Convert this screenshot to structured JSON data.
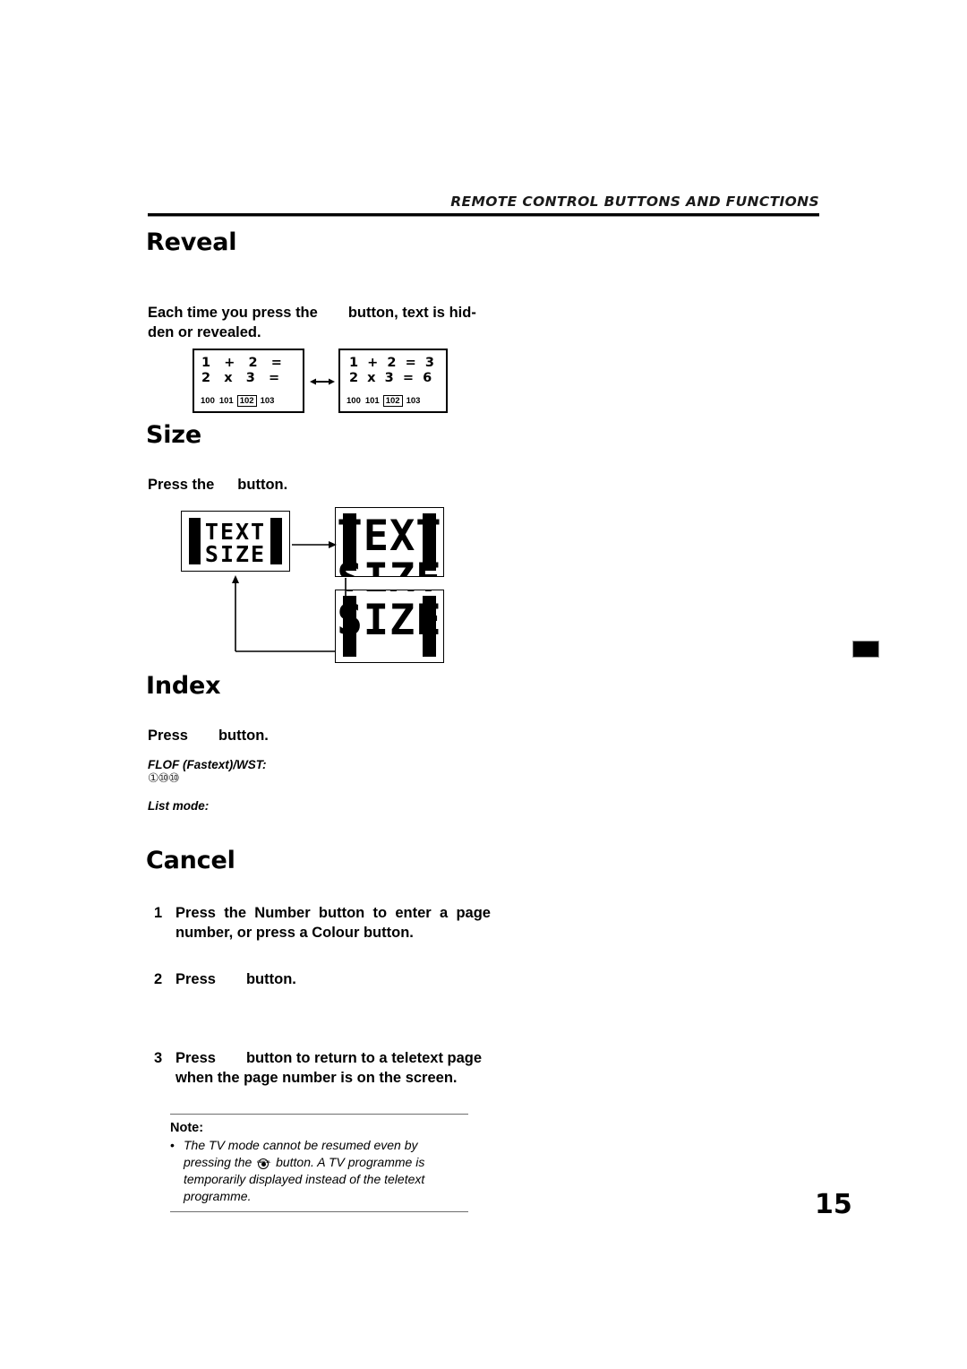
{
  "header": {
    "title": "REMOTE CONTROL BUTTONS AND FUNCTIONS"
  },
  "page_number": "15",
  "sections": {
    "reveal": {
      "heading": "Reveal",
      "paragraph_before": "Each time you press the",
      "paragraph_after": "button, text is hid-\nden or revealed.",
      "paragraph_part1": "Each time you press the",
      "paragraph_part2": "button, text is hid-",
      "paragraph_part3": "den or revealed.",
      "teletext": {
        "hidden_panel": {
          "line1": "1   +   2   =",
          "line2": "2   x   3   =",
          "pages": [
            "100",
            "101",
            "102",
            "103"
          ],
          "current_page": "102"
        },
        "revealed_panel": {
          "line1": "1  +  2  =  3",
          "line2": "2  x  3  =  6",
          "pages": [
            "100",
            "101",
            "102",
            "103"
          ],
          "current_page": "102"
        },
        "arrow": "double-headed-arrow"
      }
    },
    "size": {
      "heading": "Size",
      "paragraph_part1": "Press the",
      "paragraph_part2": "button.",
      "boxes": {
        "normal": {
          "line1": "TEXT",
          "line2": "SIZE"
        },
        "top_half": {
          "line1": "TEXT",
          "line2": "SIZE"
        },
        "bottom_half": {
          "line1": "TEXT",
          "line2": "SIZE"
        }
      }
    },
    "index": {
      "heading": "Index",
      "paragraph_part1": "Press",
      "paragraph_part2": "button.",
      "flof_label": "FLOF (Fastext)/WST:",
      "flof_keys": "①⑩⑩",
      "list_label": "List mode:"
    },
    "cancel": {
      "heading": "Cancel",
      "steps": [
        {
          "number": "1",
          "text": "Press the Number button to enter a page number, or press a Colour button."
        },
        {
          "number": "2",
          "text_part1": "Press",
          "text_part2": "button."
        },
        {
          "number": "3",
          "text_part1": "Press",
          "text_part2": "button to return to a teletext page when the page number is on the screen."
        }
      ],
      "note": {
        "label": "Note:",
        "bullet": "•",
        "text_part1": "The TV mode cannot be resumed even by pressing the",
        "icon_caption": "CANCEL",
        "text_part2": "button. A TV programme is temporarily displayed instead of the teletext programme."
      }
    }
  },
  "colors": {
    "text": "#000000",
    "rule": "#6e6e6e",
    "header_rule": "#000000"
  }
}
